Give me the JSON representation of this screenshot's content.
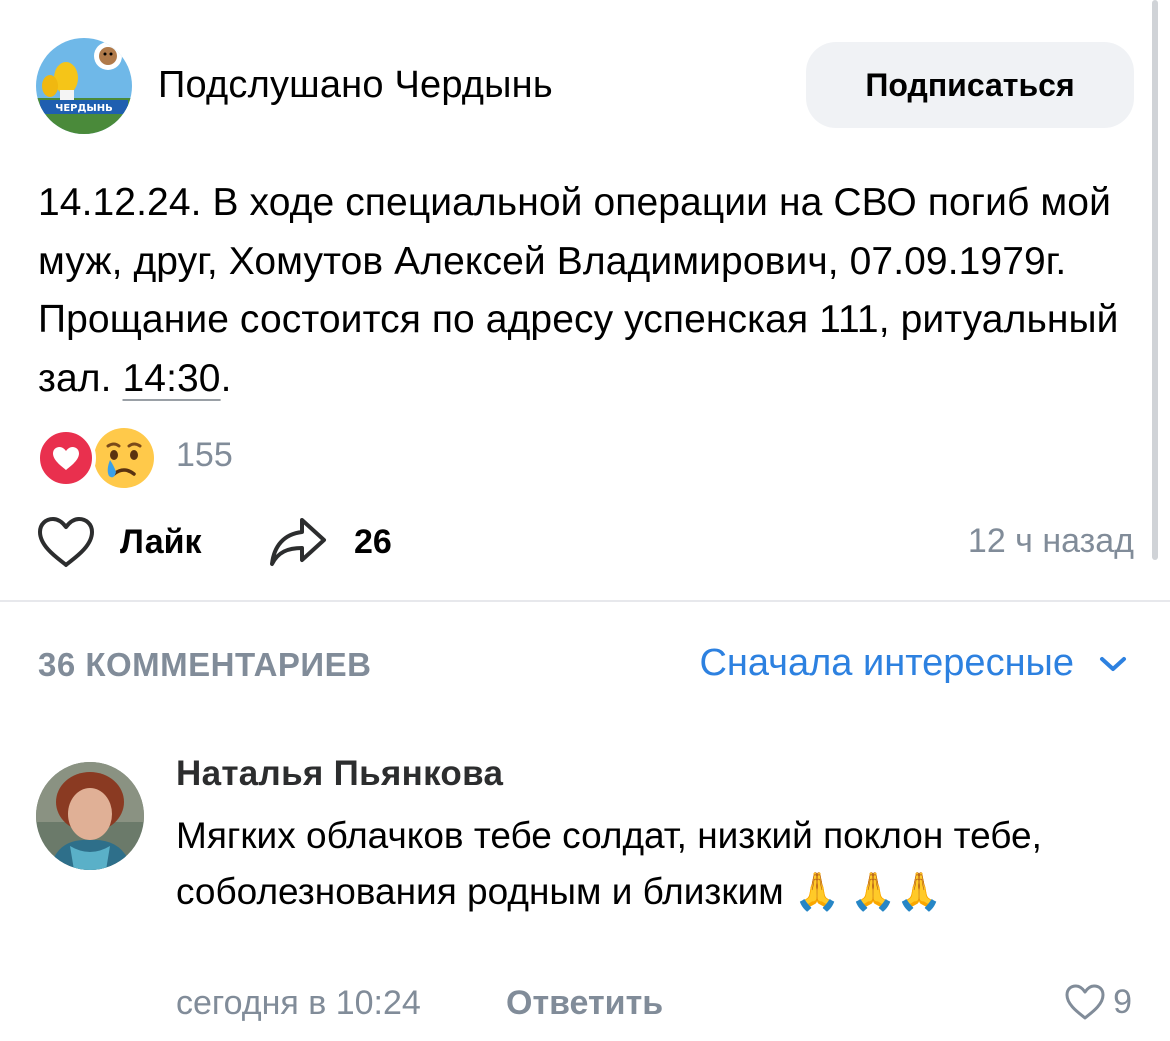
{
  "header": {
    "group_name": "Подслушано Чердынь",
    "avatar_sign": "ЧЕРДЫНЬ",
    "subscribe_label": "Подписаться"
  },
  "post": {
    "text_main": "14.12.24. В ходе специальной операции на СВО погиб мой муж, друг, Хомутов Алексей Владимирович, 07.09.1979г. Прощание состоится по адресу успенская 111, ритуальный зал. ",
    "text_time": "14:30",
    "text_end": ".",
    "reactions": [
      "heart-icon",
      "crying-face-icon"
    ],
    "reactions_count": "155",
    "like_label": "Лайк",
    "share_count": "26",
    "time": "12 ч назад"
  },
  "comments": {
    "count_label": "36 КОММЕНТАРИЕВ",
    "sort_label": "Сначала интересные",
    "items": [
      {
        "author": "Наталья Пьянкова",
        "text": "Мягких облачков тебе солдат, низкий поклон тебе, соболезнования родным и близким 🙏 🙏🙏",
        "date": "сегодня в 10:24",
        "reply_label": "Ответить",
        "likes": "9"
      }
    ]
  },
  "colors": {
    "accent": "#2d81e0",
    "secondary_text": "#818c99",
    "button_bg": "#f0f2f5",
    "heart_reaction": "#e9304e"
  }
}
